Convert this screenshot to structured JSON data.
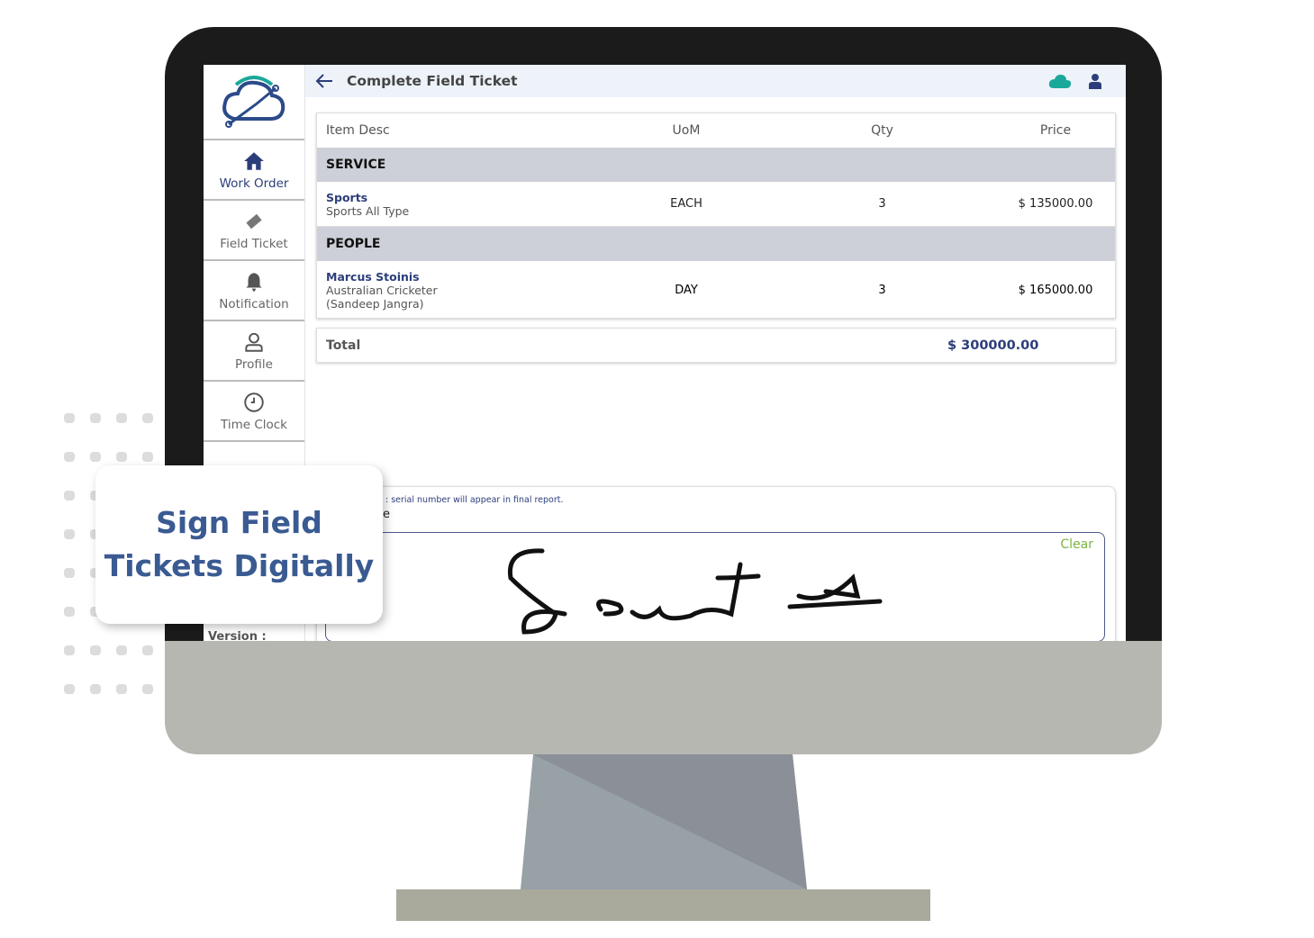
{
  "colors": {
    "accent": "#2c3e7a",
    "callout": "#3a5a92",
    "clear": "#7cb342",
    "cloud": "#1aa89a"
  },
  "header": {
    "title": "Complete Field Ticket",
    "icons": [
      "arrow-left-icon",
      "cloud-icon",
      "user-icon"
    ]
  },
  "sidebar": {
    "items": [
      {
        "label": "Work Order",
        "icon": "home-icon"
      },
      {
        "label": "Field Ticket",
        "icon": "ticket-icon"
      },
      {
        "label": "Notification",
        "icon": "bell-icon"
      },
      {
        "label": "Profile",
        "icon": "user-outline-icon"
      },
      {
        "label": "Time Clock",
        "icon": "clock-icon"
      }
    ],
    "version": "Version :"
  },
  "table": {
    "columns": [
      "Item Desc",
      "UoM",
      "Qty",
      "Price"
    ],
    "sections": [
      {
        "title": "SERVICE",
        "rows": [
          {
            "name": "Sports",
            "desc": "Sports All Type",
            "uom": "EACH",
            "qty": "3",
            "price": "$ 135000.00"
          }
        ]
      },
      {
        "title": "PEOPLE",
        "rows": [
          {
            "name": "Marcus Stoinis",
            "desc": "Australian Cricketer",
            "desc2": "(Sandeep Jangra)",
            "uom": "DAY",
            "qty": "3",
            "price": "$ 165000.00"
          }
        ]
      }
    ]
  },
  "total": {
    "label": "Total",
    "value": "$ 300000.00"
  },
  "signature": {
    "note": ": serial number will appear in final report.",
    "label_fragment": "e",
    "clear": "Clear"
  },
  "callout": {
    "line1": "Sign Field",
    "line2": "Tickets Digitally"
  }
}
